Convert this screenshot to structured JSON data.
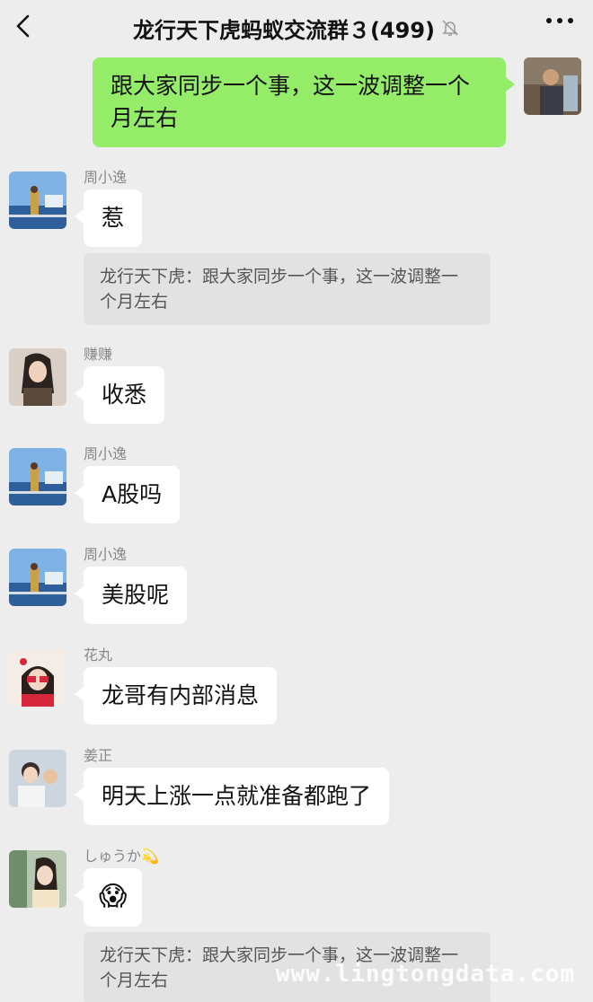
{
  "header": {
    "title": "龙行天下虎蚂蚁交流群３(499)",
    "back_icon": "chevron-left-icon",
    "mute_icon": "bell-muted-icon",
    "more_icon": "more-dots-icon"
  },
  "messages": [
    {
      "type": "mine",
      "text": "跟大家同步一个事，这一波调整一个月左右"
    },
    {
      "type": "other",
      "sender": "周小逸",
      "text": "惹",
      "quote": "龙行天下虎：跟大家同步一个事，这一波调整一个月左右"
    },
    {
      "type": "other",
      "sender": "赚赚",
      "text": "收悉"
    },
    {
      "type": "other",
      "sender": "周小逸",
      "text": "A股吗"
    },
    {
      "type": "other",
      "sender": "周小逸",
      "text": "美股呢"
    },
    {
      "type": "other",
      "sender": "花丸",
      "text": "龙哥有内部消息"
    },
    {
      "type": "other",
      "sender": "姜正",
      "text": "明天上涨一点就准备都跑了"
    },
    {
      "type": "other",
      "sender": "しゅうか💫",
      "text": "😱",
      "quote": "龙行天下虎：跟大家同步一个事，这一波调整一个月左右"
    }
  ],
  "watermark": "www.lingtongdata.com",
  "colors": {
    "background": "#ededed",
    "my_bubble": "#95ec69",
    "other_bubble": "#ffffff",
    "quote_bg": "#e2e2e2",
    "sender_text": "#888888"
  }
}
